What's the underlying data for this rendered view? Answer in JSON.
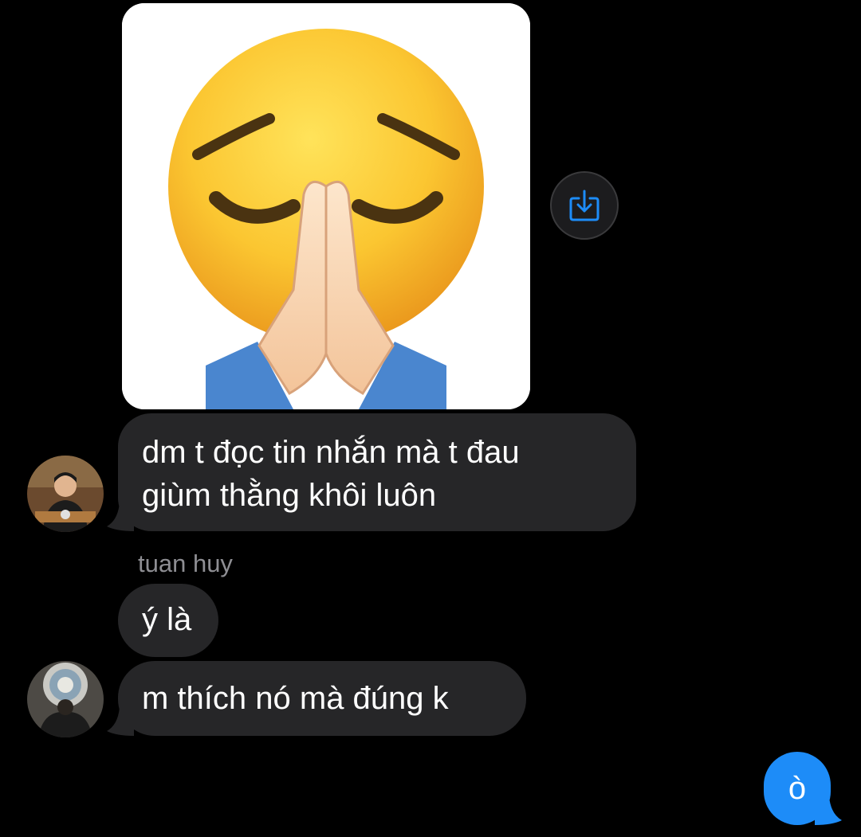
{
  "conversation": {
    "image_message": {
      "content": "pleading emoji with praying hands"
    },
    "share_button": {
      "icon": "share-download-icon",
      "accent": "#1d8cf8"
    },
    "messages": [
      {
        "text_line1": "dm t đọc tin nhắn mà t đau",
        "text_line2": "giùm thằng khôi luôn"
      },
      {
        "sender": "tuan huy",
        "text": "ý là"
      },
      {
        "text": "m thích nó mà đúng k"
      }
    ],
    "outgoing": {
      "text": "ò",
      "color": "#1d8cf8"
    }
  }
}
